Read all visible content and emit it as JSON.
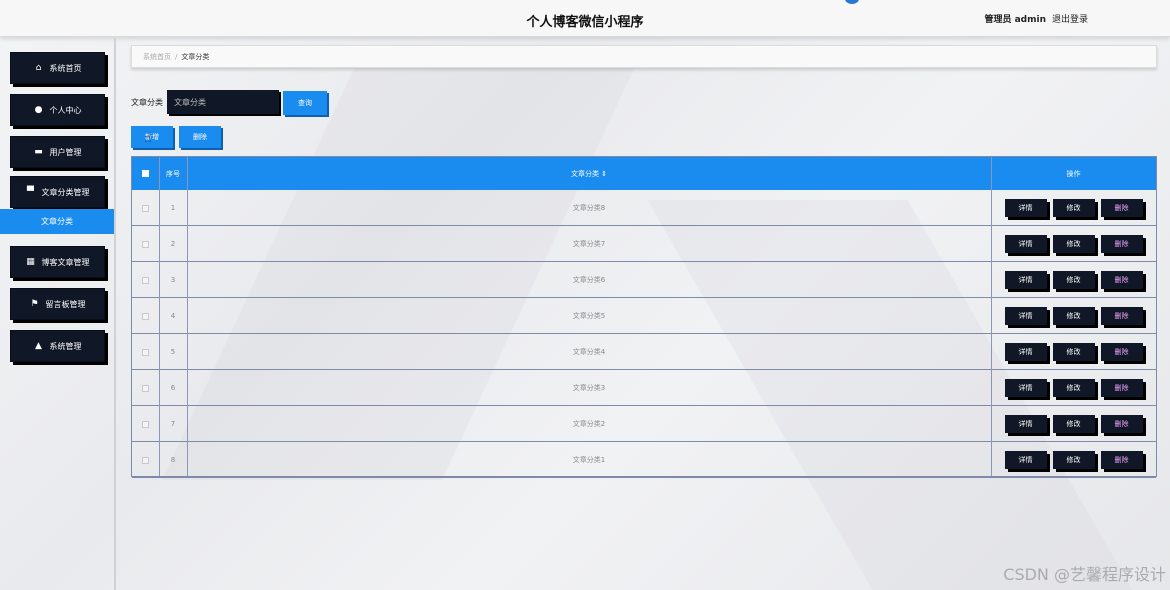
{
  "app": {
    "title": "个人博客微信小程序",
    "user_label": "管理员 admin",
    "logout_label": "退出登录"
  },
  "sidebar": {
    "items": [
      {
        "label": "系统首页",
        "icon": "home-icon",
        "glyph": "⌂"
      },
      {
        "label": "个人中心",
        "icon": "user-icon",
        "glyph": "●"
      },
      {
        "label": "用户管理",
        "icon": "card-icon",
        "glyph": "▬"
      },
      {
        "label": "文章分类管理",
        "icon": "monitor-icon",
        "glyph": "▀"
      },
      {
        "label": "博客文章管理",
        "icon": "grid-icon",
        "glyph": "▦"
      },
      {
        "label": "留言板管理",
        "icon": "flag-icon",
        "glyph": "⚑"
      },
      {
        "label": "系统管理",
        "icon": "thumb-icon",
        "glyph": "▲"
      }
    ],
    "active_sub": "文章分类"
  },
  "breadcrumb": {
    "home": "系统首页",
    "separator": "/",
    "current": "文章分类"
  },
  "search": {
    "label": "文章分类",
    "placeholder": "文章分类",
    "button": "查询"
  },
  "toolbar": {
    "add_label": "新增",
    "delete_label": "删除"
  },
  "table": {
    "headers": {
      "index": "序号",
      "category": "文章分类 ⇕",
      "actions": "操作"
    },
    "rows": [
      {
        "index": "1",
        "category": "文章分类8"
      },
      {
        "index": "2",
        "category": "文章分类7"
      },
      {
        "index": "3",
        "category": "文章分类6"
      },
      {
        "index": "4",
        "category": "文章分类5"
      },
      {
        "index": "5",
        "category": "文章分类4"
      },
      {
        "index": "6",
        "category": "文章分类3"
      },
      {
        "index": "7",
        "category": "文章分类2"
      },
      {
        "index": "8",
        "category": "文章分类1"
      }
    ],
    "row_actions": {
      "detail": "详情",
      "edit": "修改",
      "delete": "删除"
    }
  },
  "watermark": "CSDN @艺馨程序设计",
  "colors": {
    "primary_blue": "#1a8cf0",
    "dark_button": "#101726",
    "delete_text": "#f0a4ff"
  }
}
